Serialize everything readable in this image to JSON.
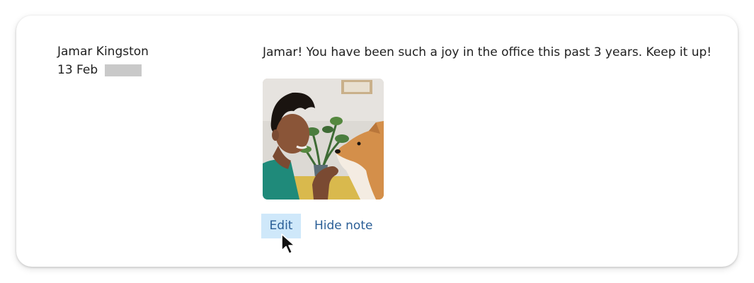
{
  "note": {
    "author_name": "Jamar Kingston",
    "date": "13 Feb",
    "message": "Jamar! You have been such a joy in the office this past 3 years. Keep it up!"
  },
  "actions": {
    "edit_label": "Edit",
    "hide_label": "Hide note"
  },
  "colors": {
    "link": "#2a5e96",
    "edit_highlight": "#cfe8fa",
    "redaction": "#c9c9c9"
  },
  "icons": {
    "cursor": "mouse-pointer-icon"
  }
}
